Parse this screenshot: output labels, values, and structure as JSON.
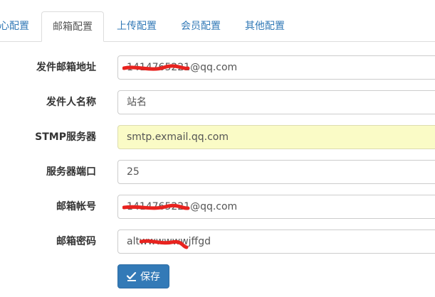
{
  "tabs": [
    {
      "label": "心配置",
      "active": false
    },
    {
      "label": "邮箱配置",
      "active": true
    },
    {
      "label": "上传配置",
      "active": false
    },
    {
      "label": "会员配置",
      "active": false
    },
    {
      "label": "其他配置",
      "active": false
    }
  ],
  "form": {
    "sender_address": {
      "label": "发件邮箱地址",
      "value": "1414765221@qq.com"
    },
    "sender_name": {
      "label": "发件人名称",
      "value": "站名"
    },
    "smtp_server": {
      "label": "STMP服务器",
      "value": "smtp.exmail.qq.com"
    },
    "server_port": {
      "label": "服务器端口",
      "value": "25"
    },
    "email_account": {
      "label": "邮箱帐号",
      "value": "1414765221@qq.com"
    },
    "email_password": {
      "label": "邮箱密码",
      "value": "altwwwwwwjffgd"
    }
  },
  "save_button": {
    "label": "保存",
    "icon": "edit-check-icon"
  },
  "colors": {
    "primary": "#337ab7",
    "tab_link": "#337ab7",
    "highlight_input": "#fafbc6",
    "redaction": "#e8231f"
  }
}
